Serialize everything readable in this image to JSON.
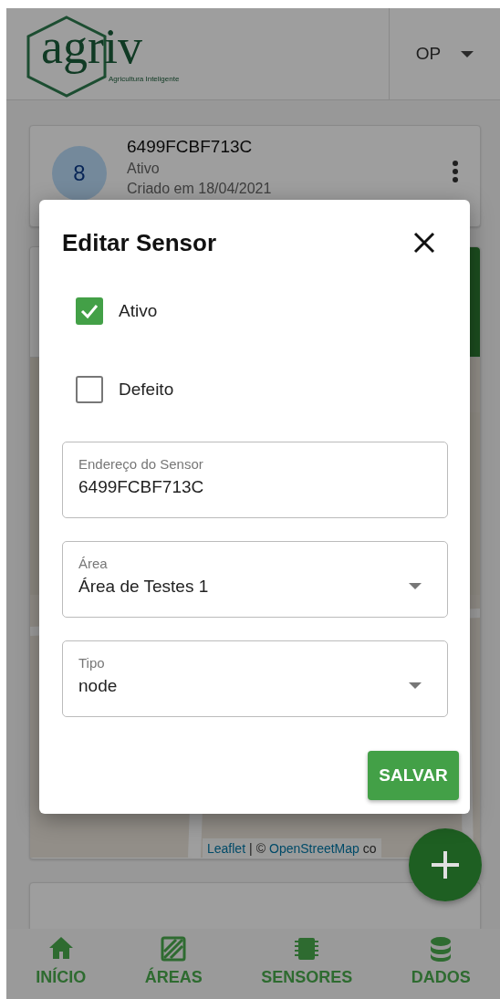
{
  "header": {
    "logo": {
      "name": "agriv",
      "tagline": "Agricultura Inteligente"
    },
    "user_menu": {
      "label": "OP"
    }
  },
  "sensor_card": {
    "avatar": "8",
    "address": "6499FCBF713C",
    "status": "Ativo",
    "created": "Criado em 18/04/2021"
  },
  "map_card": {
    "attribution": {
      "leaflet": "Leaflet",
      "separator": "|",
      "copyright": "©",
      "osm": "OpenStreetMap",
      "rest": "co"
    }
  },
  "dialog": {
    "title": "Editar Sensor",
    "checkboxes": [
      {
        "label": "Ativo",
        "checked": true
      },
      {
        "label": "Defeito",
        "checked": false
      }
    ],
    "fields": [
      {
        "kind": "text",
        "label": "Endereço do Sensor",
        "value": "6499FCBF713C"
      },
      {
        "kind": "select",
        "label": "Área",
        "value": "Área de Testes 1"
      },
      {
        "kind": "select",
        "label": "Tipo",
        "value": "node"
      }
    ],
    "save_button": "SALVAR"
  },
  "bottom_nav": [
    {
      "label": "INÍCIO"
    },
    {
      "label": "ÁREAS"
    },
    {
      "label": "SENSORES"
    },
    {
      "label": "DADOS"
    }
  ]
}
